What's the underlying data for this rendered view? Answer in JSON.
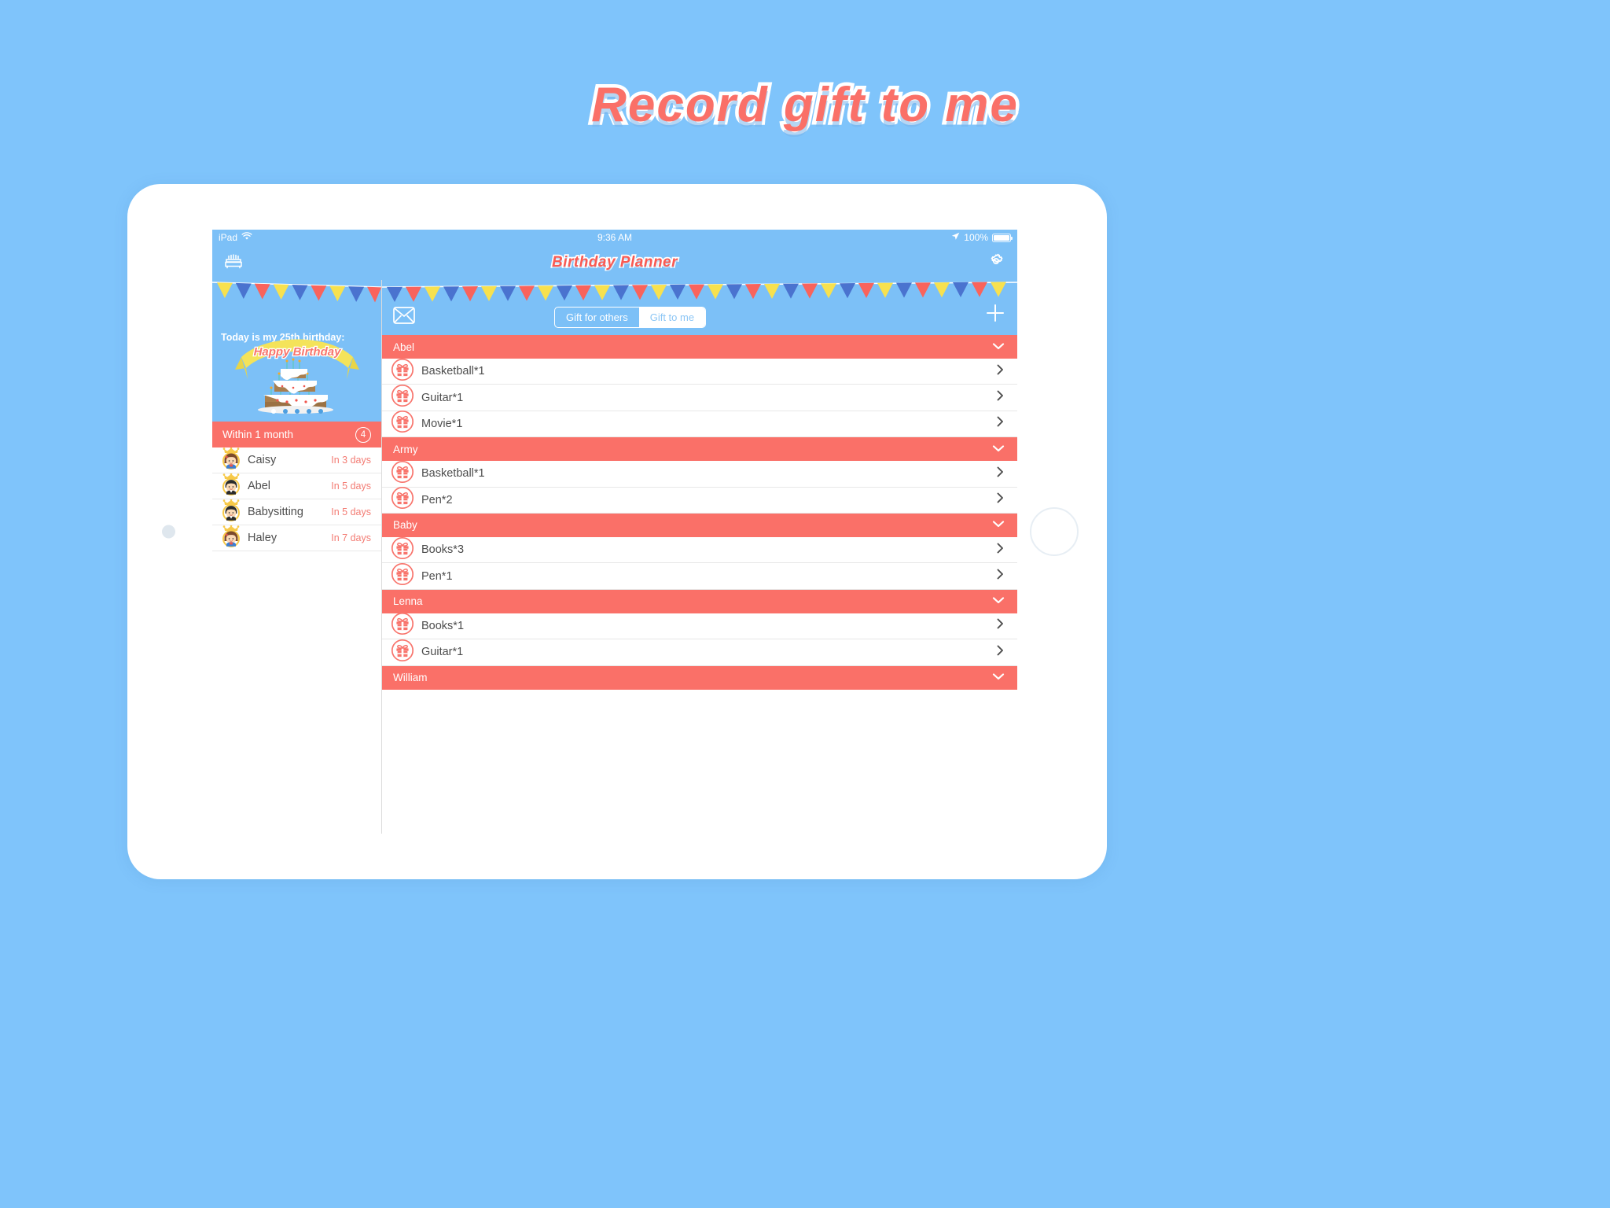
{
  "promo": {
    "title": "Record gift to me"
  },
  "status_bar": {
    "device": "iPad",
    "wifi_icon": "wifi-icon",
    "time": "9:36 AM",
    "location_icon": "location-arrow-icon",
    "battery_percent": "100%"
  },
  "navbar": {
    "left_icon": "birthday-cake-icon",
    "title": "Birthday Planner",
    "right_icon": "gear-icon"
  },
  "left_pane": {
    "hero": {
      "label": "Today is my 25th birthday:",
      "banner_text": "Happy Birthday",
      "page_dots": 5,
      "active_dot": 1
    },
    "section": {
      "title": "Within 1 month",
      "count": "4"
    },
    "friends": [
      {
        "name": "Caisy",
        "days": "In 3 days",
        "avatar": "avatar-girl-crown-icon"
      },
      {
        "name": "Abel",
        "days": "In 5 days",
        "avatar": "avatar-boy-crown-icon"
      },
      {
        "name": "Babysitting",
        "days": "In 5 days",
        "avatar": "avatar-boy-crown-icon"
      },
      {
        "name": "Haley",
        "days": "In 7 days",
        "avatar": "avatar-girl-crown-icon"
      }
    ]
  },
  "right_pane": {
    "mail_icon": "envelope-icon",
    "add_icon": "plus-icon",
    "segments": [
      {
        "label": "Gift for others",
        "active": false
      },
      {
        "label": "Gift to me",
        "active": true
      }
    ],
    "groups": [
      {
        "name": "Abel",
        "gifts": [
          "Basketball*1",
          "Guitar*1",
          "Movie*1"
        ]
      },
      {
        "name": "Army",
        "gifts": [
          "Basketball*1",
          "Pen*2"
        ]
      },
      {
        "name": "Baby",
        "gifts": [
          "Books*3",
          "Pen*1"
        ]
      },
      {
        "name": "Lenna",
        "gifts": [
          "Books*1",
          "Guitar*1"
        ]
      },
      {
        "name": "William",
        "gifts": []
      }
    ]
  },
  "colors": {
    "page_background": "#7fc4fb",
    "app_blue": "#7cc0f7",
    "coral": "#fa7068",
    "title_red": "#fa5a52",
    "bunting_yellow": "#f7e14f",
    "bunting_blue": "#4a73cf",
    "bunting_red": "#f9635c"
  }
}
